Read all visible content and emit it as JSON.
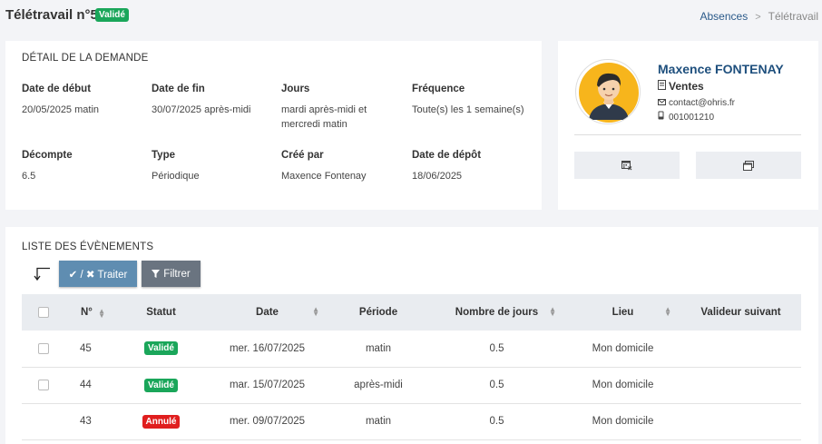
{
  "header": {
    "title": "Télétravail n°5",
    "status_badge": "Validé",
    "breadcrumb": {
      "parent": "Absences",
      "separator": ">",
      "current": "Télétravail"
    }
  },
  "detail": {
    "section_title": "DÉTAIL DE LA DEMANDE",
    "fields": [
      {
        "label": "Date de début",
        "value": "20/05/2025 matin"
      },
      {
        "label": "Date de fin",
        "value": "30/07/2025 après-midi"
      },
      {
        "label": "Jours",
        "value": "mardi après-midi et\nmercredi matin"
      },
      {
        "label": "Fréquence",
        "value": "Toute(s) les 1 semaine(s)"
      },
      {
        "label": "Décompte",
        "value": "6.5"
      },
      {
        "label": "Type",
        "value": "Périodique"
      },
      {
        "label": "Créé par",
        "value": "Maxence Fontenay"
      },
      {
        "label": "Date de dépôt",
        "value": "18/06/2025"
      }
    ]
  },
  "profile": {
    "name": "Maxence FONTENAY",
    "department": "Ventes",
    "email": "contact@ohris.fr",
    "phone": "001001210",
    "icons": {
      "department": "document-icon",
      "email": "envelope-icon",
      "phone": "phone-icon",
      "action1": "calendar-cancel-icon",
      "action2": "window-icon"
    }
  },
  "events": {
    "section_title": "LISTE DES ÉVÈNEMENTS",
    "treat_button": "✔ / ✖ Traiter",
    "filter_button": "Filtrer",
    "columns": [
      "N°",
      "Statut",
      "Date",
      "Période",
      "Nombre de jours",
      "Lieu",
      "Valideur suivant"
    ],
    "rows": [
      {
        "num": "45",
        "status": "Validé",
        "status_type": "valid",
        "date": "mer. 16/07/2025",
        "period": "matin",
        "days": "0.5",
        "place": "Mon domicile",
        "validator": "",
        "checkbox": true
      },
      {
        "num": "44",
        "status": "Validé",
        "status_type": "valid",
        "date": "mar. 15/07/2025",
        "period": "après-midi",
        "days": "0.5",
        "place": "Mon domicile",
        "validator": "",
        "checkbox": true
      },
      {
        "num": "43",
        "status": "Annulé",
        "status_type": "cancel",
        "date": "mer. 09/07/2025",
        "period": "matin",
        "days": "0.5",
        "place": "Mon domicile",
        "validator": "",
        "checkbox": false
      }
    ]
  },
  "colors": {
    "valid": "#1aa65a",
    "cancel": "#e01e1e",
    "primary": "#5f8db1",
    "name": "#1e4f7d"
  }
}
